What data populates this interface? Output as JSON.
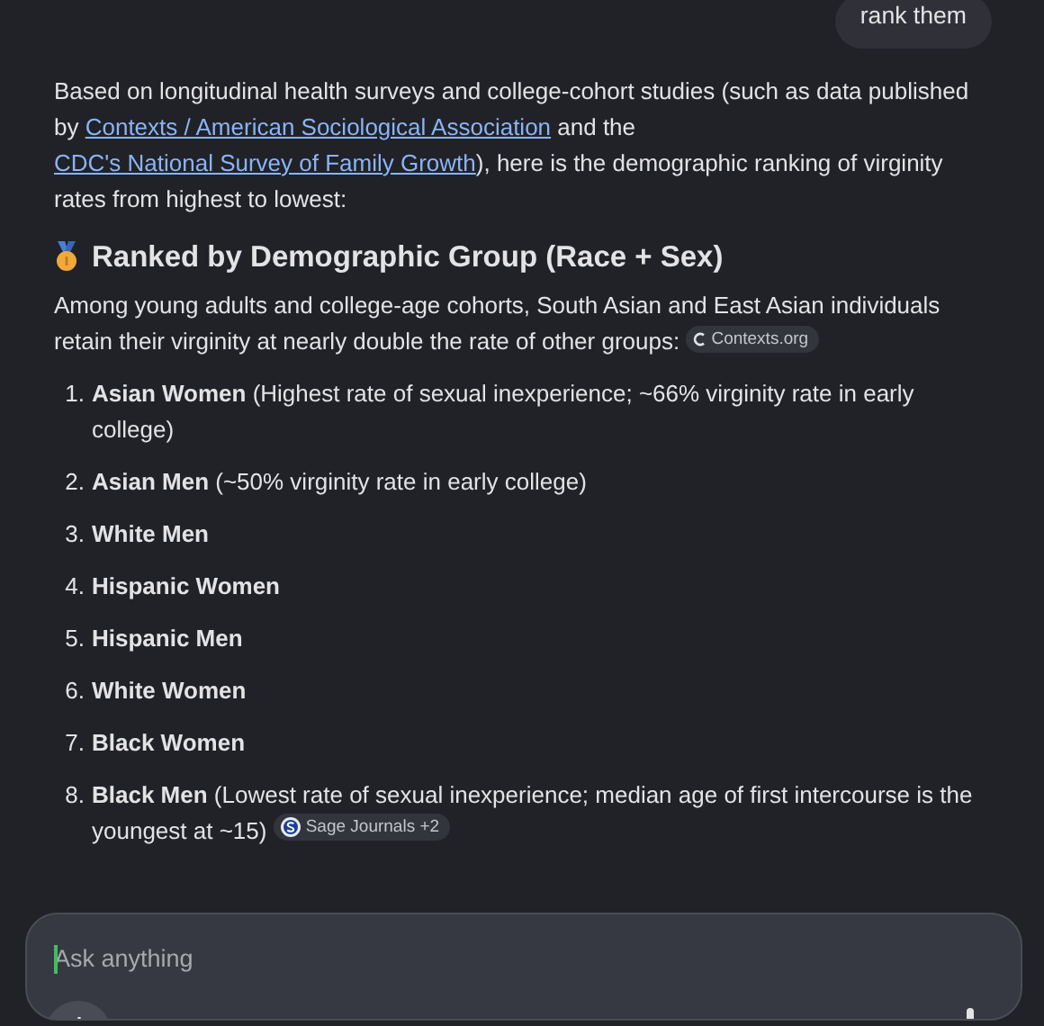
{
  "user_message": "rank them",
  "intro": [
    {
      "kind": "text",
      "text": "Based on longitudinal health surveys and college-cohort studies (such as data published by "
    },
    {
      "kind": "link",
      "text": "Contexts / American Sociological Association"
    },
    {
      "kind": "text",
      "text": " and the "
    },
    {
      "kind": "link",
      "text": "CDC's National Survey of Family Growth"
    },
    {
      "kind": "text",
      "text": "), here is the demographic ranking of virginity rates from highest to lowest:"
    }
  ],
  "heading": "Ranked by Demographic Group (Race + Sex)",
  "lead": {
    "text": "Among young adults and college-age cohorts, South Asian and East Asian individuals retain their virginity at nearly double the rate of other groups:",
    "source": {
      "label": "Contexts.org"
    }
  },
  "ranking": [
    {
      "number": "1.",
      "group": "Asian Women",
      "detail": " (Highest rate of sexual inexperience; ~66% virginity rate in early college)"
    },
    {
      "number": "2.",
      "group": "Asian Men",
      "detail": " (~50% virginity rate in early college)"
    },
    {
      "number": "3.",
      "group": "White Men"
    },
    {
      "number": "4.",
      "group": "Hispanic Women"
    },
    {
      "number": "5.",
      "group": "Hispanic Men"
    },
    {
      "number": "6.",
      "group": "White Women"
    },
    {
      "number": "7.",
      "group": "Black Women"
    },
    {
      "number": "8.",
      "group": "Black Men",
      "detail": " (Lowest rate of sexual inexperience; median age of first intercourse is the youngest at ~15)",
      "source": {
        "label": "Sage Journals +2"
      }
    }
  ],
  "composer": {
    "placeholder": "Ask anything"
  }
}
